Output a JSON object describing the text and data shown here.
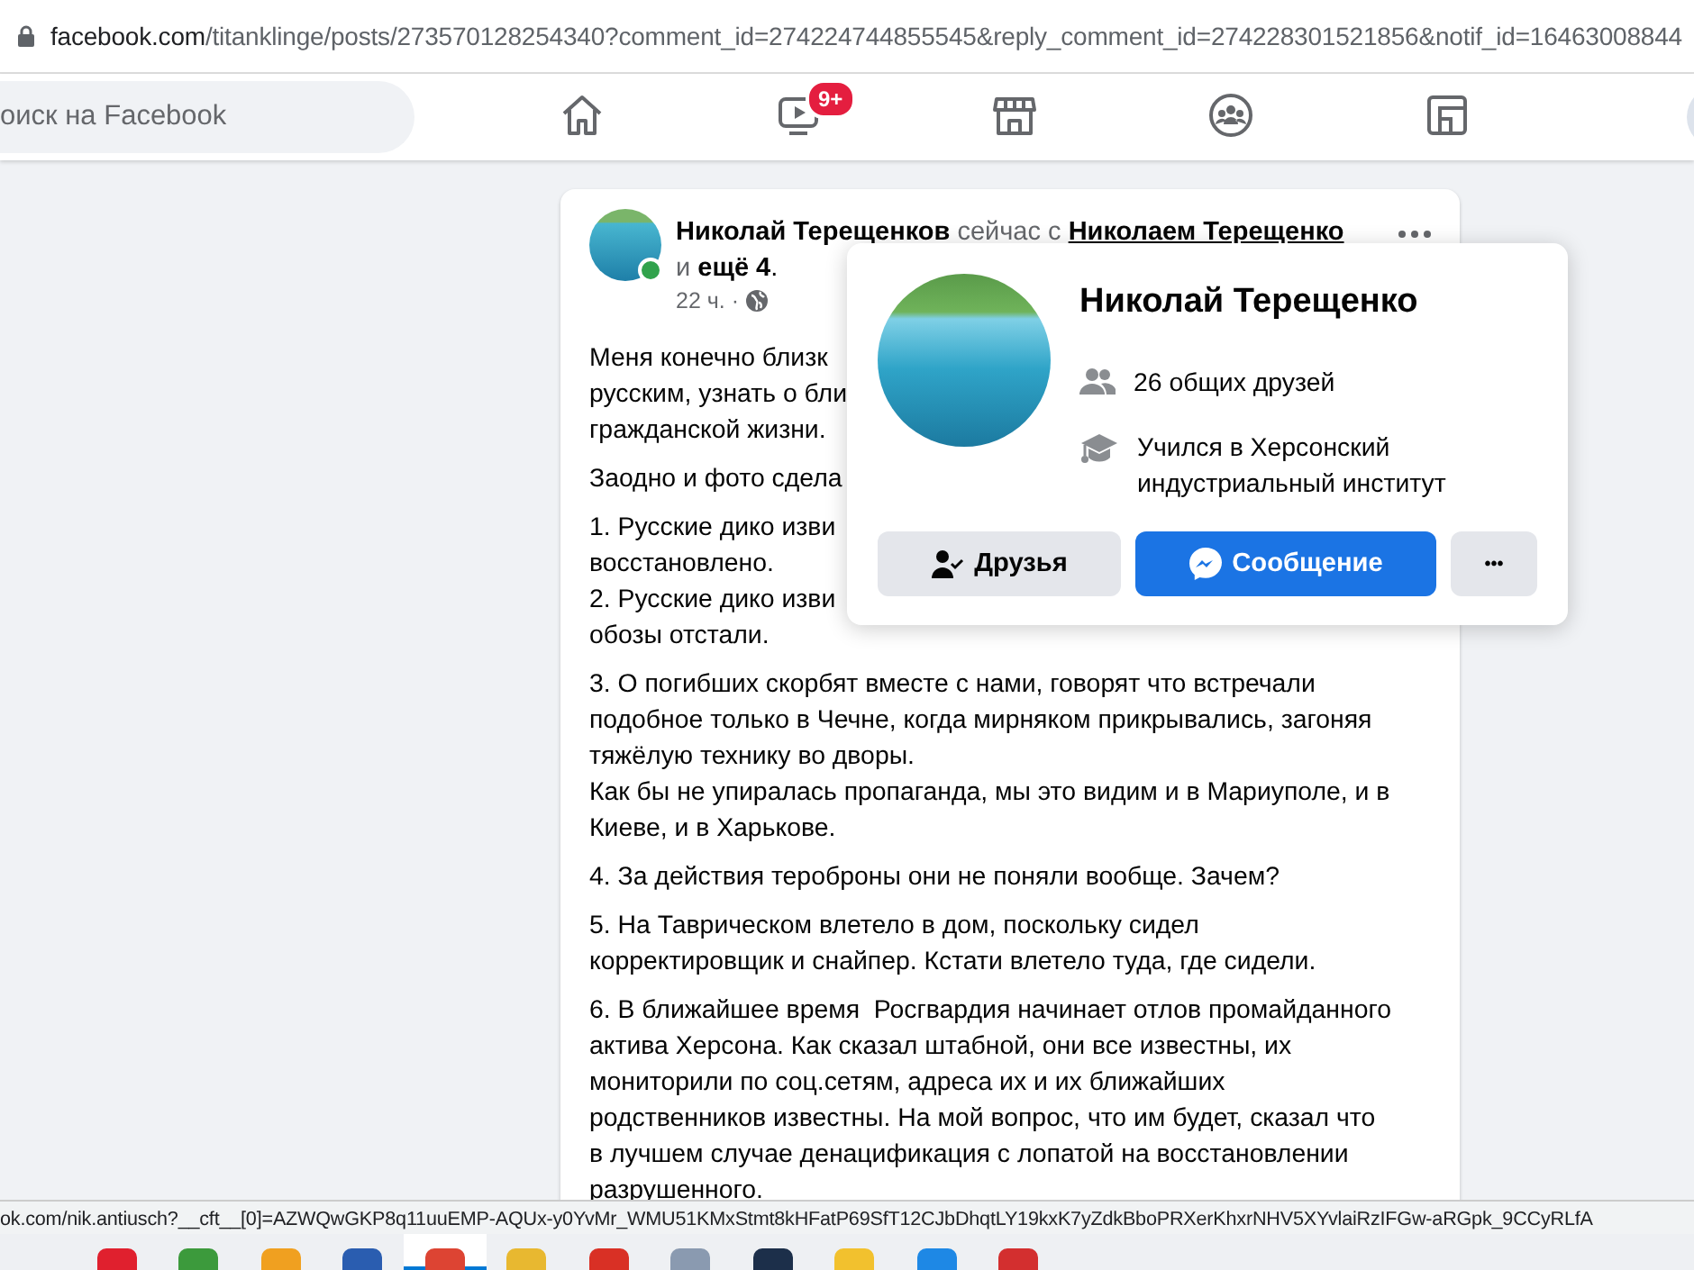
{
  "address_bar": {
    "domain": "facebook.com",
    "path": "/titanklinge/posts/273570128254340?comment_id=274224744855545&reply_comment_id=274228301521856&notif_id=16463008844"
  },
  "nav": {
    "search": {
      "placeholder": "оиск на Facebook"
    },
    "tabs": [
      {
        "kind": "home",
        "selected": false
      },
      {
        "kind": "watch",
        "selected": false,
        "badge": "9+"
      },
      {
        "kind": "marketplace",
        "selected": false
      },
      {
        "kind": "groups",
        "selected": false
      },
      {
        "kind": "gaming",
        "selected": false
      }
    ]
  },
  "post": {
    "author": "Николай Терещенков",
    "online": true,
    "with_text": "сейчас с",
    "tagged": "Николаем Терещенко",
    "and_text": "и",
    "more": "ещё 4",
    "end": ".",
    "time": "22 ч. ·",
    "paragraphs": [
      [
        "Меня конечно близк",
        "русским, узнать о бли",
        "гражданской жизни."
      ],
      [
        "Заодно и фото сдела"
      ],
      [
        "1. Русские дико изви",
        "восстановлено.",
        "2. Русские дико изви",
        "обозы отстали."
      ],
      [
        "3. О погибших скорбят вместе с нами, говорят что встречали",
        "подобное только в Чечне, когда мирняком прикрывались, загоняя",
        "тяжёлую технику во дворы.",
        "Как бы не упиралась пропаганда, мы это видим и в Мариуполе, и в",
        "Киеве, и в Харькове."
      ],
      [
        "4. За действия тероброны они не поняли вообще. Зачем?"
      ],
      [
        "5. На Таврическом влетело в дом, поскольку сидел",
        "корректировщик и снайпер. Кстати влетело туда, где сидели."
      ],
      [
        "6. В ближайшее время  Росгвардия начинает отлов промайданного",
        "актива Херсона. Как сказал штабной, они все известны, их",
        "мониторили по соц.сетям, адреса их и их ближайших",
        "родственников известны. На мой вопрос, что им будет, сказал что",
        "в лучшем случае денацификация с лопатой на восстановлении",
        "разрушенного."
      ]
    ]
  },
  "profile_card": {
    "name": "Николай Терещенко",
    "facts": [
      {
        "kind": "friends",
        "text": "26 общих друзей"
      },
      {
        "kind": "education",
        "text": "Учился в Херсонский индустриальный институт"
      }
    ],
    "buttons": [
      {
        "kind": "friends",
        "label": "Друзья"
      },
      {
        "kind": "message",
        "label": "Сообщение"
      },
      {
        "kind": "more",
        "label": "•••"
      }
    ]
  },
  "status_bar": {
    "url": "ok.com/nik.antiusch?__cft__[0]=AZWQwGKP8q11uuEMP-AQUx-y0YvMr_WMU51KMxStmt8kHFatP69SfT12CJbDhqtLY19kxK7yZdkBboPRXerKhxrNHV5XYvlaiRzIFGw-aRGpk_9CCyRLfA"
  },
  "taskbar": [
    {
      "color": "#e0202e",
      "selected": false
    },
    {
      "color": "#3c9a3c",
      "selected": false
    },
    {
      "color": "#f0a020",
      "selected": false
    },
    {
      "color": "#2a5db0",
      "selected": false
    },
    {
      "color": "#dd4433",
      "selected": true
    },
    {
      "color": "#e8b830",
      "selected": false
    },
    {
      "color": "#d93025",
      "selected": false
    },
    {
      "color": "#8a9ab0",
      "selected": false
    },
    {
      "color": "#1c2f4a",
      "selected": false
    },
    {
      "color": "#f2c12e",
      "selected": false
    },
    {
      "color": "#1e88e5",
      "selected": false
    },
    {
      "color": "#d32f2f",
      "selected": false
    }
  ]
}
